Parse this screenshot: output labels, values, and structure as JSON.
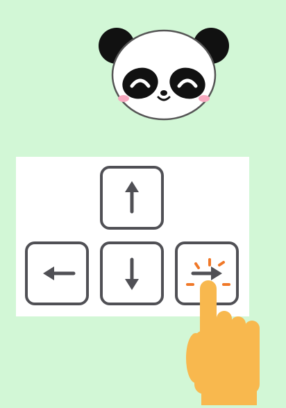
{
  "colors": {
    "background": "#d2f7d6",
    "keypad_background": "#ffffff",
    "key_border": "#505055",
    "arrow": "#505055",
    "tap_highlight": "#f07828",
    "hand": "#f8b84e"
  },
  "character": {
    "icon": "panda-face-icon"
  },
  "keys": [
    {
      "id": "up",
      "icon": "arrow-up-icon"
    },
    {
      "id": "left",
      "icon": "arrow-left-icon"
    },
    {
      "id": "down",
      "icon": "arrow-down-icon"
    },
    {
      "id": "right",
      "icon": "arrow-right-icon",
      "highlighted": true
    }
  ],
  "hint": {
    "icon": "pointing-hand-icon",
    "target": "right"
  }
}
